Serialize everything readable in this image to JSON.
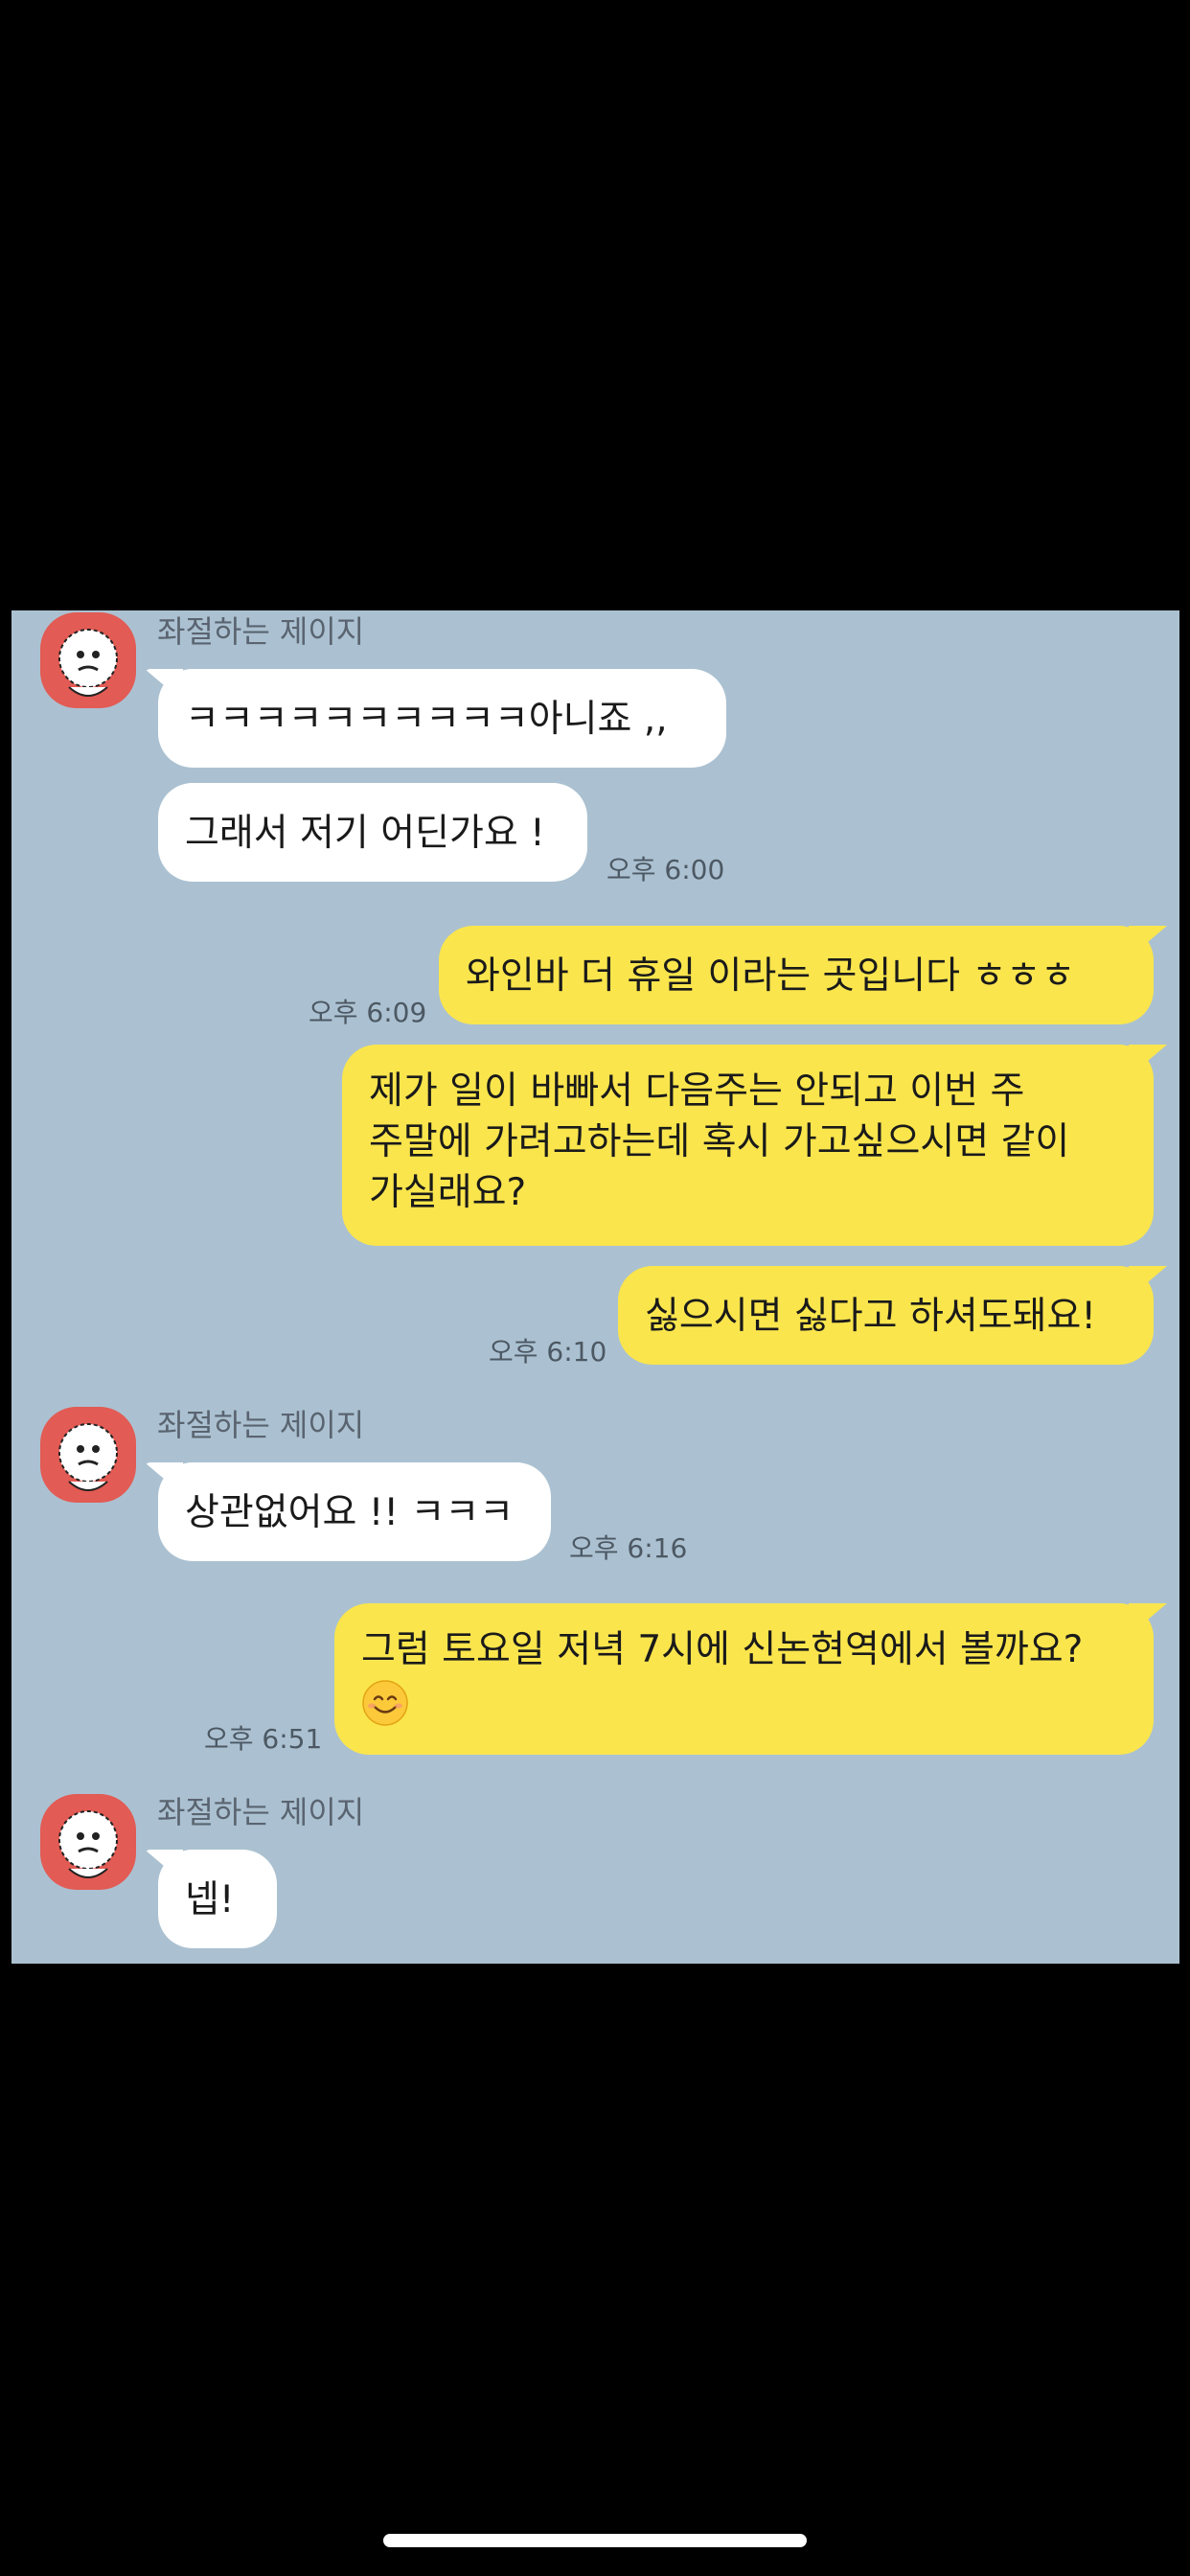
{
  "contact": {
    "name": "좌절하는 제이지"
  },
  "messages": [
    {
      "from": "them",
      "text": "ㅋㅋㅋㅋㅋㅋㅋㅋㅋㅋ아니죠 ,,"
    },
    {
      "from": "them",
      "text": "그래서 저기 어딘가요 !",
      "time": "오후 6:00"
    },
    {
      "from": "me",
      "text": "와인바 더 휴일 이라는 곳입니다 ㅎㅎㅎ",
      "time": "오후 6:09"
    },
    {
      "from": "me",
      "text": "제가 일이 바빠서 다음주는 안되고 이번 주 주말에 가려고하는데 혹시 가고싶으시면 같이 가실래요?"
    },
    {
      "from": "me",
      "text": "싫으시면 싫다고 하셔도돼요!",
      "time": "오후 6:10"
    },
    {
      "from": "them",
      "text": "상관없어요 !! ㅋㅋㅋ",
      "time": "오후 6:16"
    },
    {
      "from": "me",
      "text": "그럼 토요일 저녁 7시에 신논현역에서 볼까요?",
      "emoji": "smiling-face",
      "time": "오후 6:51"
    },
    {
      "from": "them",
      "text": "넵!"
    }
  ],
  "colors": {
    "chat_background": "#abc1d1",
    "outgoing_bubble": "#fae54d",
    "incoming_bubble": "#ffffff",
    "avatar_background": "#e25b54"
  }
}
